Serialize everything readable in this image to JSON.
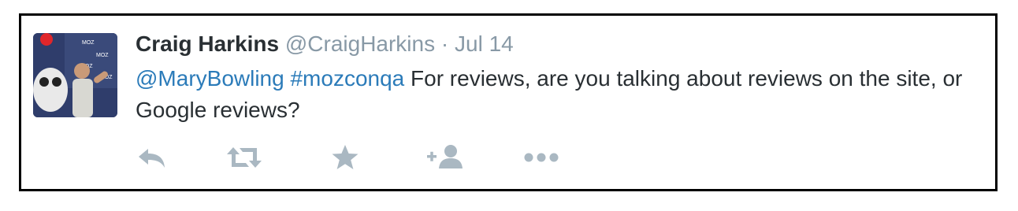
{
  "tweet": {
    "author_name": "Craig Harkins",
    "screen_name": "@CraigHarkins",
    "separator": "·",
    "timestamp": "Jul 14",
    "mention": "@MaryBowling",
    "hashtag": "#mozconqa",
    "text": "For reviews, are you talking about reviews on the site, or Google reviews?"
  },
  "actions": [
    {
      "icon": "reply-icon"
    },
    {
      "icon": "retweet-icon"
    },
    {
      "icon": "favorite-star-icon"
    },
    {
      "icon": "follow-user-plus-icon"
    },
    {
      "icon": "more-dots-icon"
    }
  ],
  "colors": {
    "name": "#292f33",
    "muted": "#8899a6",
    "link": "#2b7bb9",
    "action_icon": "#aab8c2",
    "border": "#000000"
  }
}
